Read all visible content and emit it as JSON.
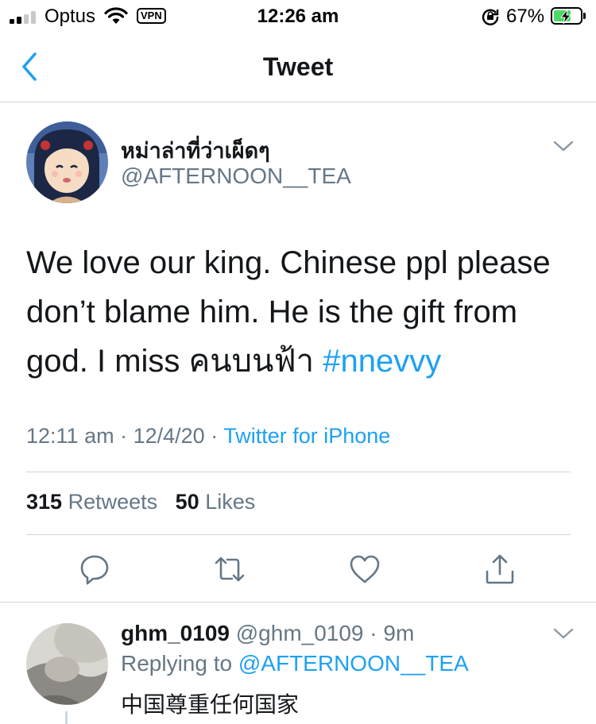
{
  "status_bar": {
    "carrier": "Optus",
    "vpn": "VPN",
    "time": "12:26 am",
    "battery": "67%",
    "battery_level": 0.67,
    "icons": [
      "signal-icon",
      "wifi-icon",
      "rotation-lock-icon",
      "battery-charging-icon"
    ]
  },
  "nav": {
    "title": "Tweet",
    "back_icon": "chevron-left-icon"
  },
  "tweet": {
    "display_name": "หม่าล่าที่ว่าเผ็ดๆ",
    "handle": "@AFTERNOON__TEA",
    "text": "We love our king. Chinese ppl please don’t  blame him.  He is the gift from god. I miss คนบนฟ้า ",
    "hashtag": "#nnevvy",
    "time": "12:11 am",
    "date": "12/4/20",
    "source": "Twitter for iPhone",
    "retweet_count": "315",
    "retweets_label": "Retweets",
    "like_count": "50",
    "likes_label": "Likes",
    "actions": [
      "reply-icon",
      "retweet-icon",
      "like-icon",
      "share-icon"
    ]
  },
  "reply": {
    "display_name": "ghm_0109",
    "handle": "@ghm_0109",
    "age": "9m",
    "replying_to_label": "Replying to",
    "replying_to": "@AFTERNOON__TEA",
    "text": "中国尊重任何国家"
  },
  "colors": {
    "accent": "#1da1f2",
    "secondary_text": "#657786",
    "primary_text": "#14171a",
    "divider": "#d0d6db",
    "battery": "#4cd964"
  }
}
